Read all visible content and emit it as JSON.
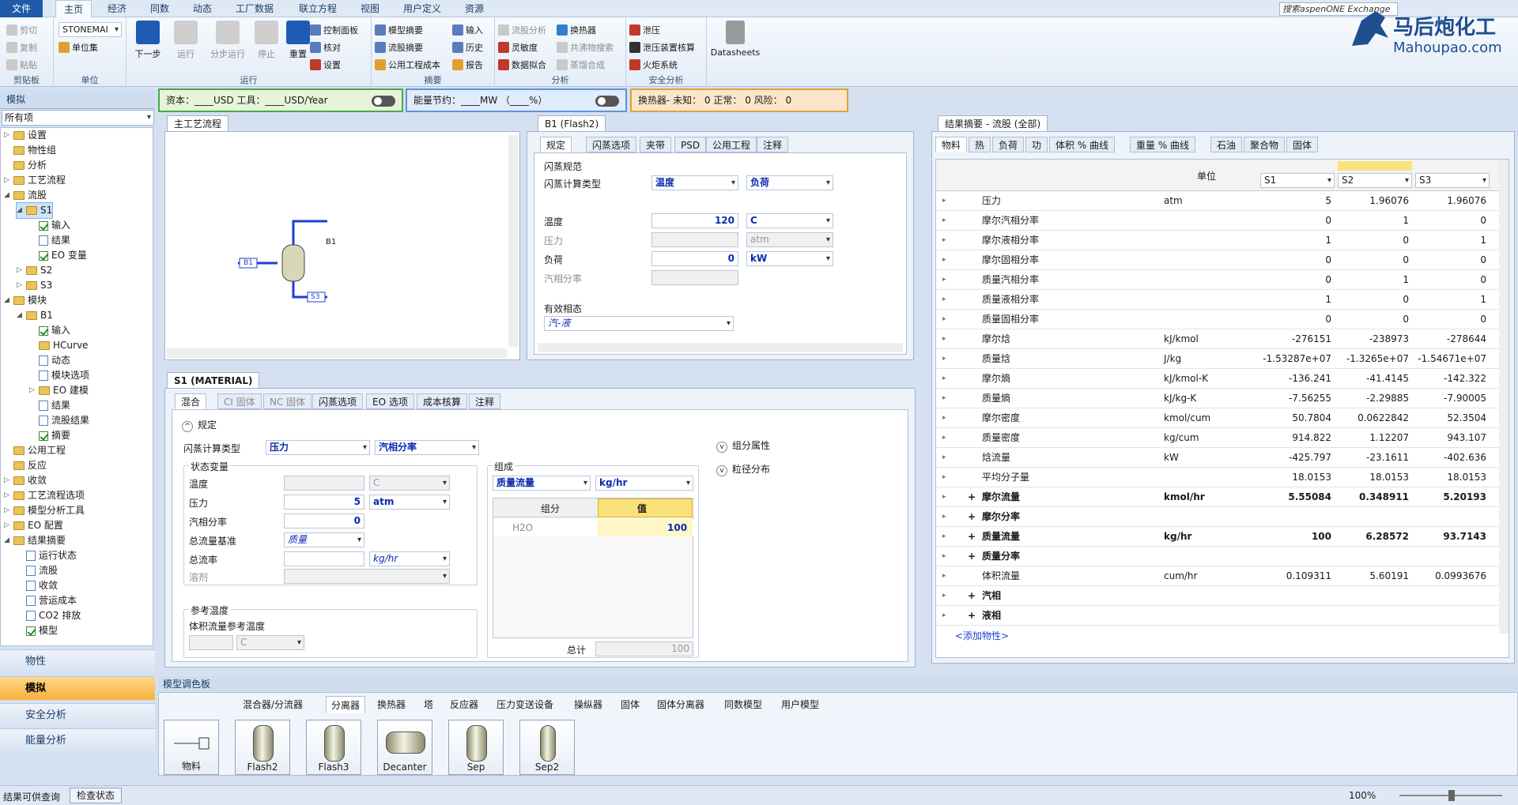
{
  "menu": {
    "tabs": [
      "文件",
      "主页",
      "经济",
      "同数",
      "动态",
      "工厂数据",
      "联立方程",
      "视图",
      "用户定义",
      "资源"
    ],
    "search_placeholder": "搜索aspenONE Exchange"
  },
  "ribbon": {
    "clipboard": {
      "label": "剪贴板",
      "cut": "剪切",
      "copy": "复制",
      "paste": "粘贴"
    },
    "units": {
      "label": "单位",
      "selector": "STONEMAI",
      "unit_set": "单位集"
    },
    "run": {
      "label": "运行",
      "next": "下一步",
      "run": "运行",
      "step": "分步运行",
      "stop": "停止",
      "reset": "重置",
      "control_panel": "控制面板",
      "check": "核对",
      "settings": "设置"
    },
    "summary": {
      "label": "摘要",
      "model_summary": "模型摘要",
      "stream_summary": "流股摘要",
      "utility_cost": "公用工程成本",
      "input": "输入",
      "history": "历史",
      "report": "报告"
    },
    "analysis": {
      "label": "分析",
      "stream_analysis": "流股分析",
      "heat_exchanger": "换热器",
      "sensitivity": "灵敏度",
      "azeotrope": "共沸物搜索",
      "data_fit": "数据拟合",
      "distill_synth": "蒸馏合成"
    },
    "safety": {
      "label": "安全分析",
      "relief": "泄压",
      "relief_sizing": "泄压装置核算",
      "flare": "火炬系统"
    },
    "datasheets": "Datasheets"
  },
  "logo": {
    "cn": "马后炮化工",
    "en": "Mahoupao.com"
  },
  "nav": {
    "header": "模拟",
    "filter": "所有项",
    "tree": [
      {
        "t": "设置",
        "lv": 0,
        "ic": "fold",
        "ex": "▷"
      },
      {
        "t": "物性组",
        "lv": 0,
        "ic": "fold"
      },
      {
        "t": "分析",
        "lv": 0,
        "ic": "fold"
      },
      {
        "t": "工艺流程",
        "lv": 0,
        "ic": "fold",
        "ex": "▷"
      },
      {
        "t": "流股",
        "lv": 0,
        "ic": "fold",
        "ex": "◢"
      },
      {
        "t": "S1",
        "lv": 1,
        "ic": "fold",
        "ex": "◢",
        "sel": true
      },
      {
        "t": "输入",
        "lv": 2,
        "ic": "chk"
      },
      {
        "t": "结果",
        "lv": 2,
        "ic": "doc"
      },
      {
        "t": "EO 变量",
        "lv": 2,
        "ic": "chk"
      },
      {
        "t": "S2",
        "lv": 1,
        "ic": "fold",
        "ex": "▷"
      },
      {
        "t": "S3",
        "lv": 1,
        "ic": "fold",
        "ex": "▷"
      },
      {
        "t": "模块",
        "lv": 0,
        "ic": "fold",
        "ex": "◢"
      },
      {
        "t": "B1",
        "lv": 1,
        "ic": "fold",
        "ex": "◢"
      },
      {
        "t": "输入",
        "lv": 2,
        "ic": "chk"
      },
      {
        "t": "HCurve",
        "lv": 2,
        "ic": "fold"
      },
      {
        "t": "动态",
        "lv": 2,
        "ic": "doc"
      },
      {
        "t": "模块选项",
        "lv": 2,
        "ic": "doc"
      },
      {
        "t": "EO 建模",
        "lv": 2,
        "ic": "fold",
        "ex": "▷"
      },
      {
        "t": "结果",
        "lv": 2,
        "ic": "doc"
      },
      {
        "t": "流股结果",
        "lv": 2,
        "ic": "doc"
      },
      {
        "t": "摘要",
        "lv": 2,
        "ic": "chk"
      },
      {
        "t": "公用工程",
        "lv": 0,
        "ic": "fold"
      },
      {
        "t": "反应",
        "lv": 0,
        "ic": "fold"
      },
      {
        "t": "收敛",
        "lv": 0,
        "ic": "fold",
        "ex": "▷"
      },
      {
        "t": "工艺流程选项",
        "lv": 0,
        "ic": "fold",
        "ex": "▷"
      },
      {
        "t": "模型分析工具",
        "lv": 0,
        "ic": "fold",
        "ex": "▷"
      },
      {
        "t": "EO 配置",
        "lv": 0,
        "ic": "fold",
        "ex": "▷"
      },
      {
        "t": "结果摘要",
        "lv": 0,
        "ic": "fold",
        "ex": "◢"
      },
      {
        "t": "运行状态",
        "lv": 1,
        "ic": "doc"
      },
      {
        "t": "流股",
        "lv": 1,
        "ic": "doc"
      },
      {
        "t": "收敛",
        "lv": 1,
        "ic": "doc"
      },
      {
        "t": "营运成本",
        "lv": 1,
        "ic": "doc"
      },
      {
        "t": "CO2 排放",
        "lv": 1,
        "ic": "doc"
      },
      {
        "t": "模型",
        "lv": 1,
        "ic": "chk"
      }
    ],
    "buttons": [
      "物性",
      "模拟",
      "安全分析",
      "能量分析"
    ]
  },
  "energy": {
    "capital": "资本：____USD  工具：____USD/Year",
    "saving": "能量节约：____MW （____%）",
    "hx": "换热器- 未知： 0  正常： 0  风险： 0"
  },
  "flowsheet": {
    "tab": "主工艺流程",
    "block": "B1",
    "streams": [
      "B1",
      "S3"
    ]
  },
  "b1": {
    "tab": "B1 (Flash2)",
    "subtabs": [
      "规定",
      "闪蒸选项",
      "夹带",
      "PSD",
      "公用工程",
      "注释"
    ],
    "group": "闪蒸规范",
    "flash_type_label": "闪蒸计算类型",
    "flash_type_1": "温度",
    "flash_type_2": "负荷",
    "temp_label": "温度",
    "temp_value": "120",
    "temp_unit": "C",
    "pressure_label": "压力",
    "pressure_unit": "atm",
    "duty_label": "负荷",
    "duty_value": "0",
    "duty_unit": "kW",
    "vf_label": "汽相分率",
    "phase_group": "有效相态",
    "phase_value": "汽-液"
  },
  "s1": {
    "tab": "S1 (MATERIAL)",
    "subtabs": [
      "混合",
      "CI 固体",
      "NC 固体",
      "闪蒸选项",
      "EO 选项",
      "成本核算",
      "注释"
    ],
    "spec": "规定",
    "flash_type_label": "闪蒸计算类型",
    "flash_type_1": "压力",
    "flash_type_2": "汽相分率",
    "state_group": "状态变量",
    "temp_label": "温度",
    "temp_unit": "C",
    "pressure_label": "压力",
    "pressure_value": "5",
    "pressure_unit": "atm",
    "vf_label": "汽相分率",
    "vf_value": "0",
    "basis_label": "总流量基准",
    "basis_value": "质量",
    "rate_label": "总流率",
    "rate_unit": "kg/hr",
    "solvent_label": "溶剂",
    "ref_group": "参考温度",
    "ref_label": "体积流量参考温度",
    "ref_unit": "C",
    "comp_group": "组成",
    "comp_basis": "质量流量",
    "comp_unit": "kg/hr",
    "comp_col1": "组分",
    "comp_col2": "值",
    "comp_name": "H2O",
    "comp_value": "100",
    "total_label": "总计",
    "total_value": "100",
    "extra1": "组分属性",
    "extra2": "粒径分布"
  },
  "results": {
    "tab": "结果摘要 - 流股 (全部)",
    "tabs": [
      "物料",
      "热",
      "负荷",
      "功",
      "体积 % 曲线",
      "重量 % 曲线",
      "石油",
      "聚合物",
      "固体"
    ],
    "unit_header": "单位",
    "streams": [
      "S1",
      "S2",
      "S3"
    ],
    "rows": [
      {
        "name": "压力",
        "unit": "atm",
        "v": [
          "5",
          "1.96076",
          "1.96076"
        ]
      },
      {
        "name": "摩尔汽相分率",
        "unit": "",
        "v": [
          "0",
          "1",
          "0"
        ]
      },
      {
        "name": "摩尔液相分率",
        "unit": "",
        "v": [
          "1",
          "0",
          "1"
        ]
      },
      {
        "name": "摩尔固相分率",
        "unit": "",
        "v": [
          "0",
          "0",
          "0"
        ]
      },
      {
        "name": "质量汽相分率",
        "unit": "",
        "v": [
          "0",
          "1",
          "0"
        ]
      },
      {
        "name": "质量液相分率",
        "unit": "",
        "v": [
          "1",
          "0",
          "1"
        ]
      },
      {
        "name": "质量固相分率",
        "unit": "",
        "v": [
          "0",
          "0",
          "0"
        ]
      },
      {
        "name": "摩尔焓",
        "unit": "kJ/kmol",
        "v": [
          "-276151",
          "-238973",
          "-278644"
        ]
      },
      {
        "name": "质量焓",
        "unit": "J/kg",
        "v": [
          "-1.53287e+07",
          "-1.3265e+07",
          "-1.54671e+07"
        ]
      },
      {
        "name": "摩尔熵",
        "unit": "kJ/kmol-K",
        "v": [
          "-136.241",
          "-41.4145",
          "-142.322"
        ]
      },
      {
        "name": "质量熵",
        "unit": "kJ/kg-K",
        "v": [
          "-7.56255",
          "-2.29885",
          "-7.90005"
        ]
      },
      {
        "name": "摩尔密度",
        "unit": "kmol/cum",
        "v": [
          "50.7804",
          "0.0622842",
          "52.3504"
        ]
      },
      {
        "name": "质量密度",
        "unit": "kg/cum",
        "v": [
          "914.822",
          "1.12207",
          "943.107"
        ]
      },
      {
        "name": "焓流量",
        "unit": "kW",
        "v": [
          "-425.797",
          "-23.1611",
          "-402.636"
        ]
      },
      {
        "name": "平均分子量",
        "unit": "",
        "v": [
          "18.0153",
          "18.0153",
          "18.0153"
        ]
      },
      {
        "name": "摩尔流量",
        "unit": "kmol/hr",
        "v": [
          "5.55084",
          "0.348911",
          "5.20193"
        ],
        "bold": true,
        "plus": true
      },
      {
        "name": "摩尔分率",
        "unit": "",
        "v": [
          "",
          "",
          ""
        ],
        "bold": true,
        "plus": true
      },
      {
        "name": "质量流量",
        "unit": "kg/hr",
        "v": [
          "100",
          "6.28572",
          "93.7143"
        ],
        "bold": true,
        "plus": true
      },
      {
        "name": "质量分率",
        "unit": "",
        "v": [
          "",
          "",
          ""
        ],
        "bold": true,
        "plus": true
      },
      {
        "name": "体积流量",
        "unit": "cum/hr",
        "v": [
          "0.109311",
          "5.60191",
          "0.0993676"
        ]
      },
      {
        "name": "汽相",
        "unit": "",
        "v": [
          "",
          "",
          ""
        ],
        "bold": true,
        "plus": true
      },
      {
        "name": "液相",
        "unit": "",
        "v": [
          "",
          "",
          ""
        ],
        "bold": true,
        "plus": true
      }
    ],
    "add_prop": "<添加物性>"
  },
  "palette": {
    "header": "模型调色板",
    "tabs": [
      "混合器/分流器",
      "分离器",
      "换热器",
      "塔",
      "反应器",
      "压力变送设备",
      "操纵器",
      "固体",
      "固体分离器",
      "同数模型",
      "用户模型"
    ],
    "items": [
      "物料",
      "Flash2",
      "Flash3",
      "Decanter",
      "Sep",
      "Sep2"
    ]
  },
  "status": {
    "left": "结果可供查询",
    "check": "检查状态",
    "zoom": "100%"
  }
}
